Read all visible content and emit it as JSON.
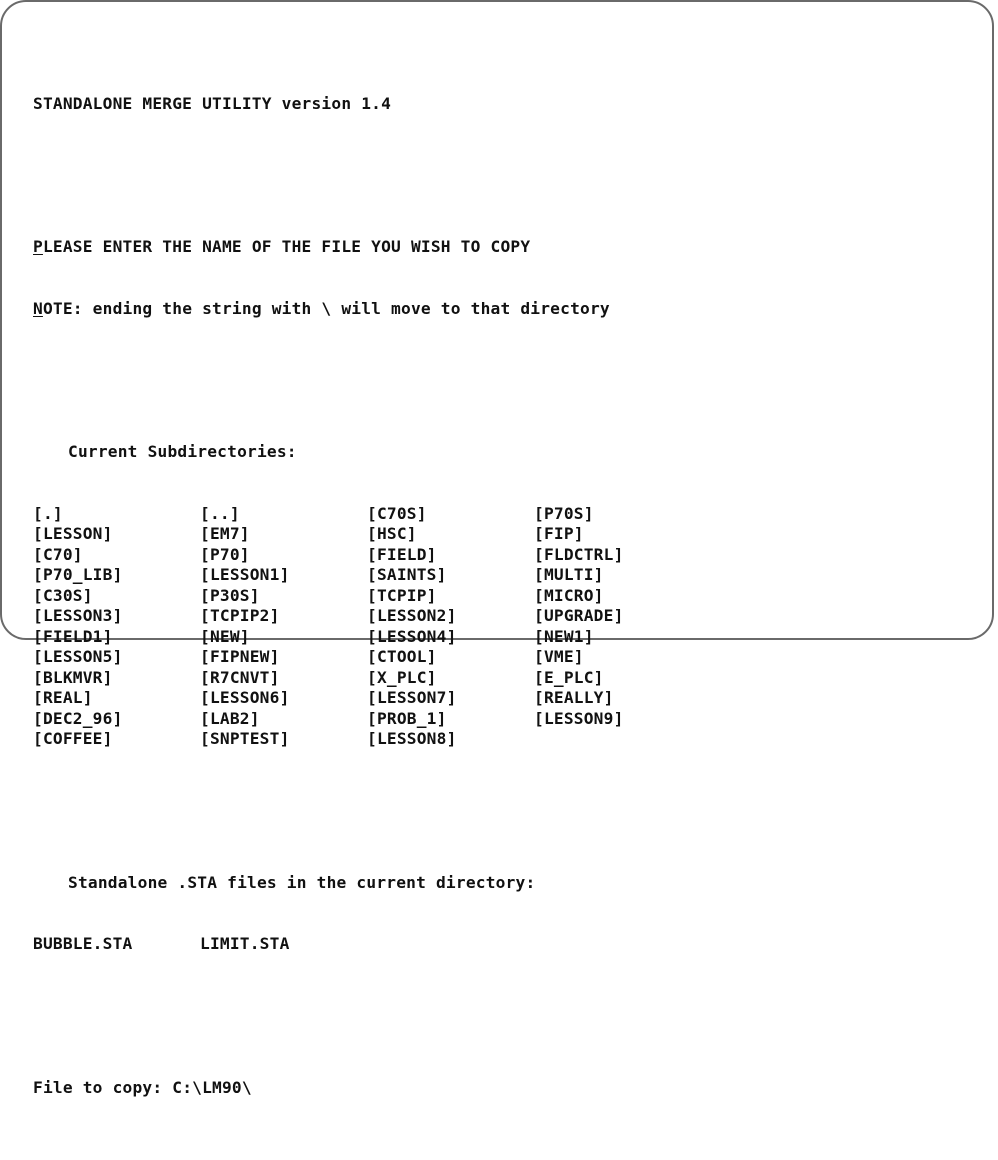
{
  "header": {
    "title": "STANDALONE MERGE UTILITY version 1.4"
  },
  "prompt": {
    "line1_first_char": "P",
    "line1_rest": "LEASE ENTER THE NAME OF THE FILE YOU WISH TO COPY",
    "line2_first_char": "N",
    "line2_rest": "OTE: ending the string with \\ will move to that directory"
  },
  "subdirectories": {
    "heading": "Current Subdirectories:",
    "items": [
      "[.]",
      "[..]",
      "[C70S]",
      "[P70S]",
      "[LESSON]",
      "[EM7]",
      "[HSC]",
      "[FIP]",
      "[C70]",
      "[P70]",
      "[FIELD]",
      "[FLDCTRL]",
      "[P70_LIB]",
      "[LESSON1]",
      "[SAINTS]",
      "[MULTI]",
      "[C30S]",
      "[P30S]",
      "[TCPIP]",
      "[MICRO]",
      "[LESSON3]",
      "[TCPIP2]",
      "[LESSON2]",
      "[UPGRADE]",
      "[FIELD1]",
      "[NEW]",
      "[LESSON4]",
      "[NEW1]",
      "[LESSON5]",
      "[FIPNEW]",
      "[CTOOL]",
      "[VME]",
      "[BLKMVR]",
      "[R7CNVT]",
      "[X_PLC]",
      "[E_PLC]",
      "[REAL]",
      "[LESSON6]",
      "[LESSON7]",
      "[REALLY]",
      "[DEC2_96]",
      "[LAB2]",
      "[PROB_1]",
      "[LESSON9]",
      "[COFFEE]",
      "[SNPTEST]",
      "[LESSON8]"
    ]
  },
  "sta_files": {
    "heading": "Standalone .STA files in the current directory:",
    "items": [
      "BUBBLE.STA",
      "LIMIT.STA"
    ]
  },
  "input": {
    "label": "File to copy: ",
    "value": "C:\\LM90\\"
  }
}
